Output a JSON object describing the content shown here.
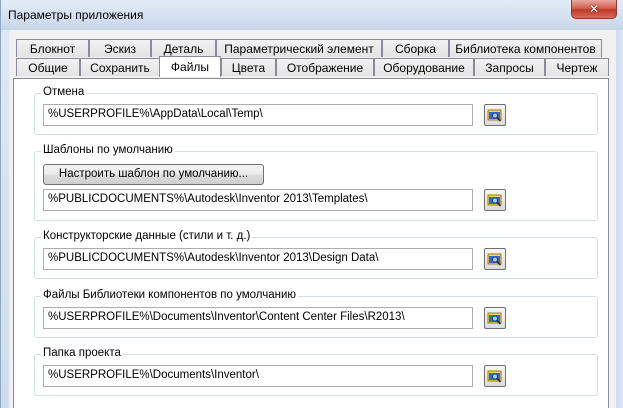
{
  "window": {
    "title": "Параметры приложения",
    "close_symbol": "✕"
  },
  "tabs_row1": [
    "Блокнот",
    "Эскиз",
    "Деталь",
    "Параметрический элемент",
    "Сборка",
    "Библиотека компонентов"
  ],
  "tabs_row2": [
    "Общие",
    "Сохранить",
    "Файлы",
    "Цвета",
    "Отображение",
    "Оборудование",
    "Запросы",
    "Чертеж"
  ],
  "active_tab": "Файлы",
  "groups": {
    "undo": {
      "label": "Отмена",
      "path": "%USERPROFILE%\\AppData\\Local\\Temp\\"
    },
    "templates": {
      "label": "Шаблоны по умолчанию",
      "button_label": "Настроить шаблон по умолчанию...",
      "path": "%PUBLICDOCUMENTS%\\Autodesk\\Inventor 2013\\Templates\\"
    },
    "design_data": {
      "label": "Конструкторские данные (стили и т. д.)",
      "path": "%PUBLICDOCUMENTS%\\Autodesk\\Inventor 2013\\Design Data\\"
    },
    "content_center": {
      "label": "Файлы Библиотеки компонентов по умолчанию",
      "path": "%USERPROFILE%\\Documents\\Inventor\\Content Center Files\\R2013\\"
    },
    "project": {
      "label": "Папка проекта",
      "path": "%USERPROFILE%\\Documents\\Inventor\\"
    }
  },
  "icons": {
    "browse": "browse-folder-icon"
  }
}
